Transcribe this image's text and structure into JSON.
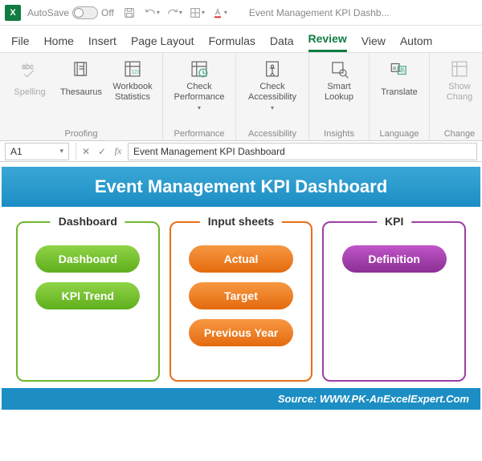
{
  "titlebar": {
    "autosave_label": "AutoSave",
    "autosave_state": "Off",
    "doc_title": "Event Management KPI Dashb..."
  },
  "tabs": {
    "items": [
      {
        "label": "File"
      },
      {
        "label": "Home"
      },
      {
        "label": "Insert"
      },
      {
        "label": "Page Layout"
      },
      {
        "label": "Formulas"
      },
      {
        "label": "Data"
      },
      {
        "label": "Review"
      },
      {
        "label": "View"
      },
      {
        "label": "Autom"
      }
    ],
    "active_index": 6
  },
  "ribbon": {
    "groups": [
      {
        "label": "Proofing",
        "buttons": [
          {
            "label": "Spelling",
            "icon": "spelling-icon",
            "disabled": true
          },
          {
            "label": "Thesaurus",
            "icon": "thesaurus-icon"
          },
          {
            "label": "Workbook Statistics",
            "icon": "stats-icon"
          }
        ]
      },
      {
        "label": "Performance",
        "buttons": [
          {
            "label": "Check Performance",
            "icon": "perf-icon",
            "dropdown": true
          }
        ]
      },
      {
        "label": "Accessibility",
        "buttons": [
          {
            "label": "Check Accessibility",
            "icon": "access-icon",
            "dropdown": true
          }
        ]
      },
      {
        "label": "Insights",
        "buttons": [
          {
            "label": "Smart Lookup",
            "icon": "lookup-icon"
          }
        ]
      },
      {
        "label": "Language",
        "buttons": [
          {
            "label": "Translate",
            "icon": "translate-icon"
          }
        ]
      },
      {
        "label": "Change",
        "buttons": [
          {
            "label": "Show Chang",
            "icon": "changes-icon",
            "disabled": true
          }
        ]
      }
    ]
  },
  "formula_bar": {
    "cell_ref": "A1",
    "formula": "Event Management KPI Dashboard",
    "fx_label": "fx"
  },
  "dashboard": {
    "title": "Event Management KPI Dashboard",
    "footer": "Source: WWW.PK-AnExcelExpert.Com",
    "panels": [
      {
        "title": "Dashboard",
        "color": "green",
        "pills": [
          "Dashboard",
          "KPI Trend"
        ]
      },
      {
        "title": "Input sheets",
        "color": "orange",
        "pills": [
          "Actual",
          "Target",
          "Previous Year"
        ]
      },
      {
        "title": "KPI",
        "color": "purple",
        "pills": [
          "Definition"
        ]
      }
    ]
  }
}
